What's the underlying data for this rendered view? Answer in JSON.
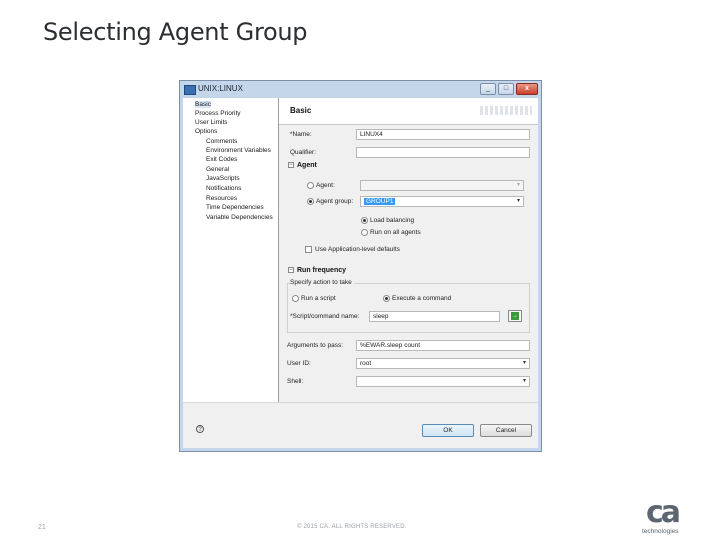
{
  "slide": {
    "title": "Selecting Agent Group",
    "page_number": "21",
    "copyright": "© 2015 CA. ALL RIGHTS RESERVED.",
    "logo": {
      "mark": "ca",
      "tagline": "technologies"
    }
  },
  "window": {
    "title": "UNIX:LINUX",
    "controls": {
      "minimize": "_",
      "maximize": "□",
      "close": "x"
    }
  },
  "tree": {
    "items": [
      {
        "label": "Basic",
        "level": 0,
        "selected": true
      },
      {
        "label": "Process Priority",
        "level": 0
      },
      {
        "label": "User Limits",
        "level": 0
      },
      {
        "label": "Options",
        "level": 0
      },
      {
        "label": "Comments",
        "level": 1
      },
      {
        "label": "Environment Variables",
        "level": 1
      },
      {
        "label": "Exit Codes",
        "level": 1
      },
      {
        "label": "General",
        "level": 1
      },
      {
        "label": "JavaScripts",
        "level": 1
      },
      {
        "label": "Notifications",
        "level": 1
      },
      {
        "label": "Resources",
        "level": 1
      },
      {
        "label": "Time Dependencies",
        "level": 1
      },
      {
        "label": "Variable Dependencies",
        "level": 1
      }
    ]
  },
  "page": {
    "title": "Basic",
    "name": {
      "label": "*Name:",
      "value": "LINUX4"
    },
    "qualifier": {
      "label": "Qualifier:",
      "value": ""
    },
    "agent_section": {
      "title": "Agent",
      "toggle": "−",
      "agent": {
        "label": "Agent:",
        "selected": false,
        "value": ""
      },
      "agent_group": {
        "label": "Agent group:",
        "selected": true,
        "value": "GROUP1"
      },
      "load_balancing": {
        "label": "Load balancing",
        "selected": true
      },
      "run_on_all": {
        "label": "Run on all agents",
        "selected": false
      },
      "use_app_defaults": {
        "label": "Use Application-level defaults",
        "checked": false
      }
    },
    "run_frequency": {
      "title": "Run frequency",
      "toggle": "−",
      "specify_label": "Specify action to take",
      "run_script": {
        "label": "Run a script",
        "selected": false
      },
      "execute_command": {
        "label": "Execute a command",
        "selected": true
      },
      "script_name": {
        "label": "*Script/command name:",
        "value": "sleep"
      }
    },
    "arguments": {
      "label": "Arguments to pass:",
      "value": "%EWAR.sleep count"
    },
    "user_id": {
      "label": "User ID:",
      "value": "root"
    },
    "shell": {
      "label": "Shell:",
      "value": ""
    },
    "dropdown_arrow": "▾"
  },
  "footer": {
    "help": "?",
    "ok": "OK",
    "cancel": "Cancel"
  }
}
